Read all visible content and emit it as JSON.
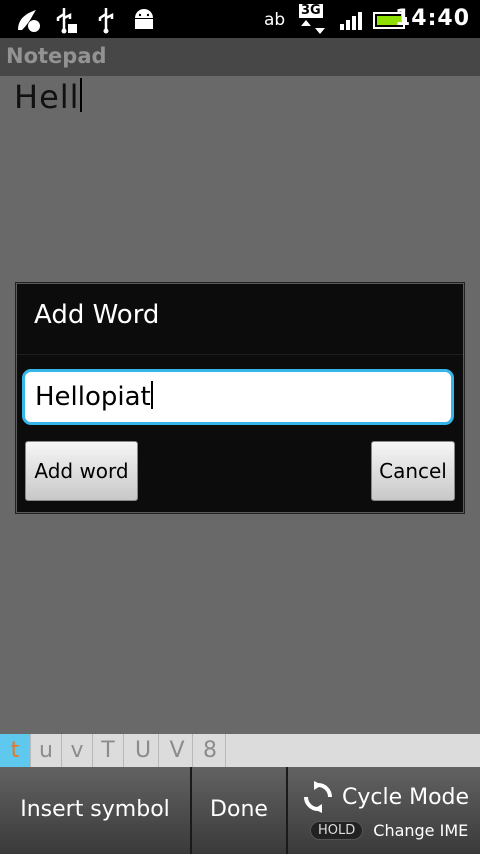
{
  "status_bar": {
    "icons": [
      "app-notification-icon",
      "usb-icon",
      "usb-debug-icon",
      "usb-icon",
      "android-debug-icon"
    ],
    "ime_indicator": "ab",
    "network": "3G",
    "clock": "14:40"
  },
  "app": {
    "title": "Notepad"
  },
  "note": {
    "text": "Hell"
  },
  "dialog": {
    "title": "Add Word",
    "input_value": "Hellopiat",
    "add_button": "Add word",
    "cancel_button": "Cancel"
  },
  "candidates": [
    "t",
    "u",
    "v",
    "T",
    "U",
    "V",
    "8"
  ],
  "keyboard_bar": {
    "insert_symbol": "Insert symbol",
    "done": "Done",
    "cycle_mode": "Cycle Mode",
    "hold": "HOLD",
    "change_ime": "Change IME"
  },
  "colors": {
    "accent_blue": "#35b5e8",
    "battery_green": "#8ee000",
    "candidate_highlight": "#5ec8ef",
    "candidate_orange": "#f0741c"
  }
}
